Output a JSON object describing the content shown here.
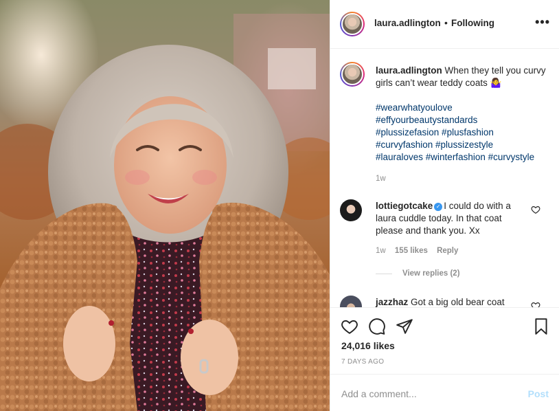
{
  "post": {
    "username": "laura.adlington",
    "dot": "•",
    "follow_status": "Following",
    "more_icon": "more-options-icon"
  },
  "caption": {
    "username": "laura.adlington",
    "text": "When they tell you curvy girls can’t wear teddy coats",
    "emoji": "🤷‍♀️",
    "hashtags": [
      "#wearwhatyoulove",
      "#effyourbeautystandards",
      "#plussizefasion #plusfashion",
      "#curvyfashion #plussizestyle",
      "#lauraloves #winterfashion #curvystyle"
    ],
    "age": "1w"
  },
  "comments": [
    {
      "username": "lottiegotcake",
      "verified": true,
      "text_line1": "I could do with a",
      "text_line2": "laura cuddle today. In that coat",
      "text_line3": "please and thank you. Xx",
      "age": "1w",
      "likes": "155 likes",
      "reply": "Reply",
      "view_replies": "View replies (2)"
    },
    {
      "username": "jazzhaz",
      "text": "Got a big old bear coat"
    }
  ],
  "actions": {
    "likes": "24,016 likes",
    "time": "7 DAYS AGO"
  },
  "add_comment": {
    "placeholder": "Add a comment...",
    "post_label": "Post"
  },
  "colors": {
    "hashtag": "#00376b",
    "post_button_disabled": "#b2dffc",
    "meta_gray": "#8e8e8e"
  }
}
